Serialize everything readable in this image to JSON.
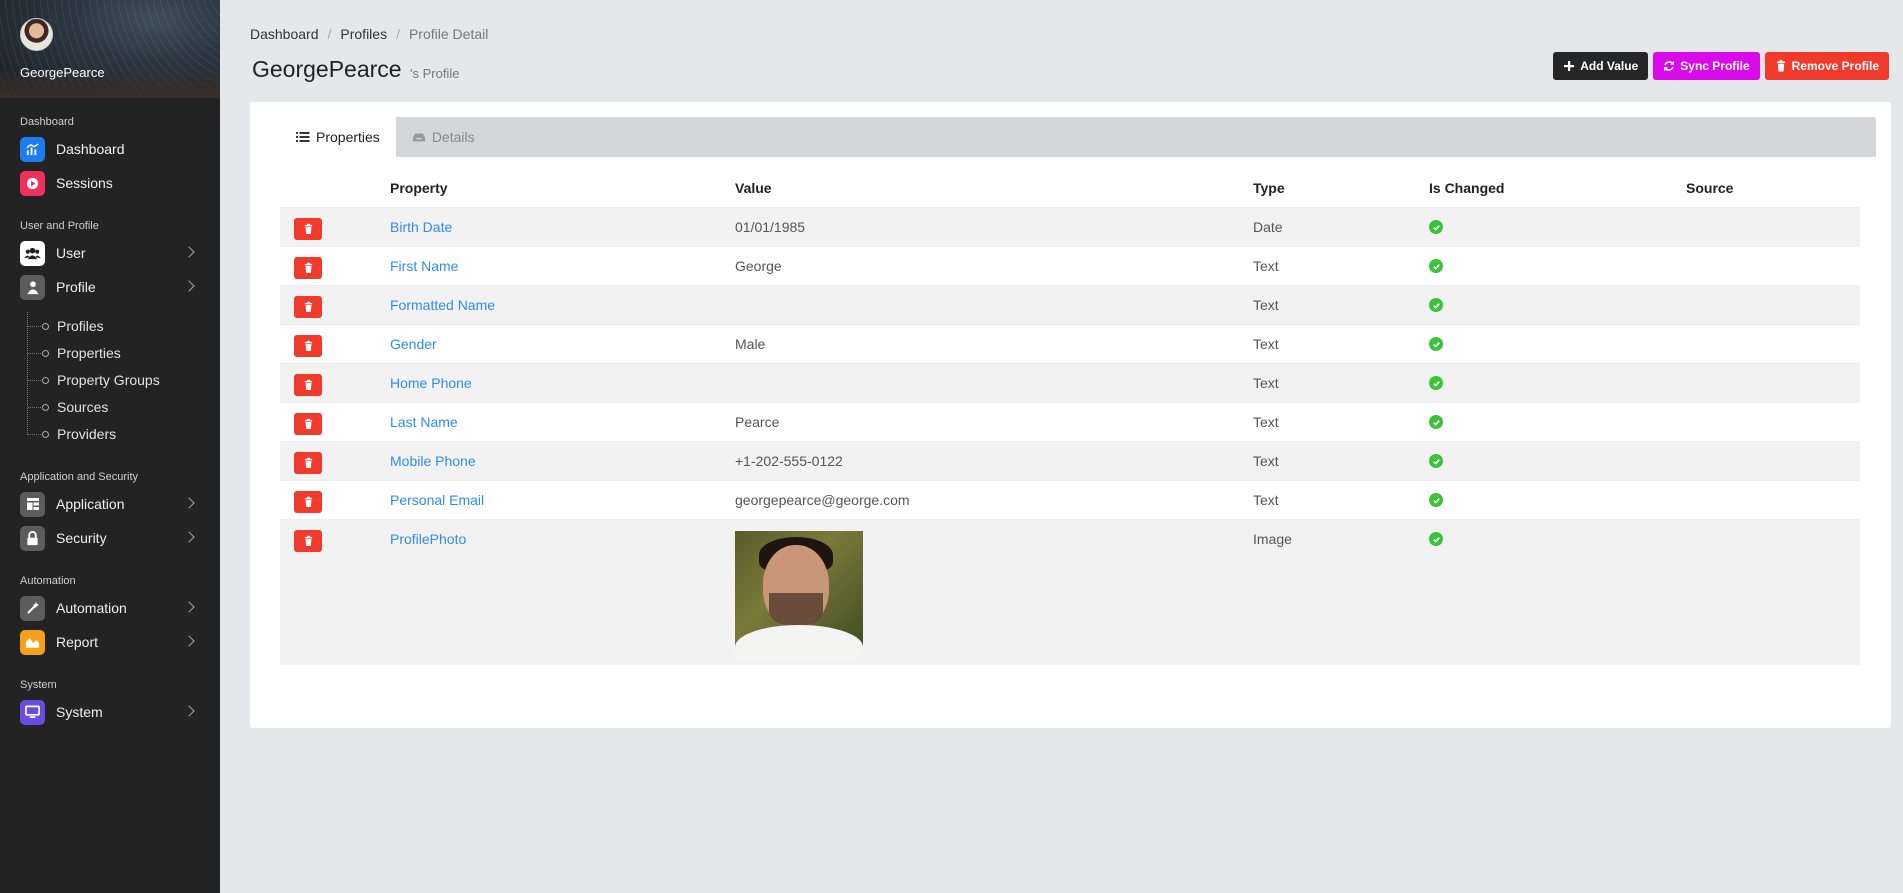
{
  "sidebar": {
    "username": "GeorgePearce",
    "sections": {
      "dashboard": "Dashboard",
      "user_profile": "User and Profile",
      "app_security": "Application and Security",
      "automation": "Automation",
      "system": "System"
    },
    "items": {
      "dashboard": "Dashboard",
      "sessions": "Sessions",
      "user": "User",
      "profile": "Profile",
      "application": "Application",
      "security": "Security",
      "automation": "Automation",
      "report": "Report",
      "system": "System"
    },
    "profile_sub": [
      "Profiles",
      "Properties",
      "Property Groups",
      "Sources",
      "Providers"
    ],
    "icon_colors": {
      "dashboard": "#1e7cf0",
      "sessions": "#f0305a",
      "user": "#ffffff",
      "profile": "#5c5c5c",
      "application": "#5c5c5c",
      "security": "#5c5c5c",
      "automation": "#5c5c5c",
      "report": "#f5a01a",
      "system": "#6a4de0"
    }
  },
  "breadcrumb": [
    "Dashboard",
    "Profiles",
    "Profile Detail"
  ],
  "header": {
    "title": "GeorgePearce",
    "subtitle": "'s Profile"
  },
  "actions": {
    "add_value": "Add Value",
    "sync_profile": "Sync Profile",
    "remove_profile": "Remove Profile"
  },
  "tabs": {
    "properties": "Properties",
    "details": "Details"
  },
  "table": {
    "headers": {
      "property": "Property",
      "value": "Value",
      "type": "Type",
      "is_changed": "Is Changed",
      "source": "Source"
    },
    "rows": [
      {
        "property": "Birth Date",
        "value": "01/01/1985",
        "type": "Date",
        "is_changed": true,
        "source": ""
      },
      {
        "property": "First Name",
        "value": "George",
        "type": "Text",
        "is_changed": true,
        "source": ""
      },
      {
        "property": "Formatted Name",
        "value": "",
        "type": "Text",
        "is_changed": true,
        "source": ""
      },
      {
        "property": "Gender",
        "value": "Male",
        "type": "Text",
        "is_changed": true,
        "source": ""
      },
      {
        "property": "Home Phone",
        "value": "",
        "type": "Text",
        "is_changed": true,
        "source": ""
      },
      {
        "property": "Last Name",
        "value": "Pearce",
        "type": "Text",
        "is_changed": true,
        "source": ""
      },
      {
        "property": "Mobile Phone",
        "value": "+1-202-555-0122",
        "type": "Text",
        "is_changed": true,
        "source": ""
      },
      {
        "property": "Personal Email",
        "value": "georgepearce@george.com",
        "type": "Text",
        "is_changed": true,
        "source": ""
      },
      {
        "property": "ProfilePhoto",
        "value": "",
        "type": "Image",
        "is_changed": true,
        "source": ""
      }
    ]
  },
  "colors": {
    "link": "#2e8ded",
    "delete": "#f03a2c",
    "check": "#3bc43b",
    "sync": "#d90bea"
  }
}
